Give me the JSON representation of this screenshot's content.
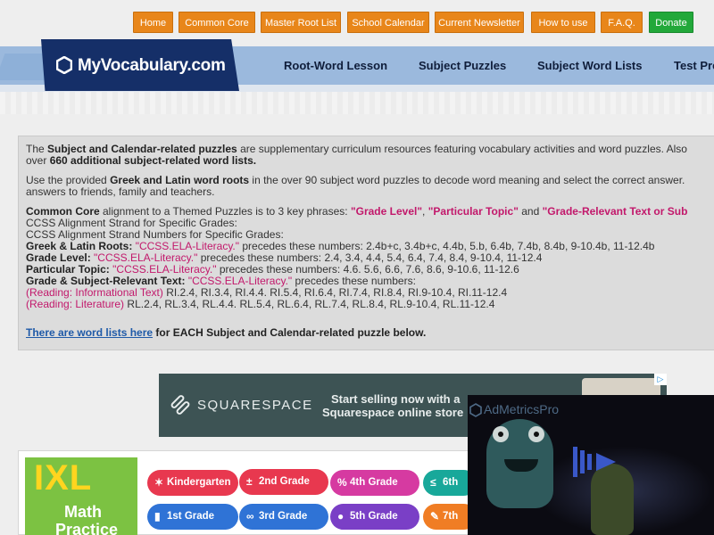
{
  "top_nav": [
    {
      "label": "Home"
    },
    {
      "label": "Common Core"
    },
    {
      "label": "Master Root List"
    },
    {
      "label": "School Calendar"
    },
    {
      "label": "Current Newsletter"
    },
    {
      "label": "How to use"
    },
    {
      "label": "F.A.Q."
    },
    {
      "label": "Donate"
    }
  ],
  "logo": {
    "text": "MyVocabulary.com"
  },
  "main_nav": [
    {
      "label": "Root-Word Lesson"
    },
    {
      "label": "Subject Puzzles"
    },
    {
      "label": "Subject Word Lists"
    },
    {
      "label": "Test Pre"
    }
  ],
  "intro": {
    "p1a": "The ",
    "p1b": "Subject and Calendar-related puzzles",
    "p1c": " are supplementary curriculum resources featuring vocabulary activities and word puzzles. Also",
    "p1d": "over ",
    "p1e": "660 additional subject-related word lists.",
    "p2a": "Use the provided ",
    "p2b": "Greek and Latin word roots",
    "p2c": " in the over 90 subject word puzzles to decode word meaning and select the correct answer.",
    "p2d": "answers to friends, family and teachers."
  },
  "common_core": {
    "l1a": "Common Core",
    "l1b": " alignment to a Themed Puzzles is to 3 key phrases: ",
    "phrase1": "\"Grade Level\"",
    "comma": ", ",
    "phrase2": "\"Particular Topic\"",
    "and": " and ",
    "phrase3": "\"Grade-Relevant Text or Sub",
    "l2": "CCSS Alignment Strand for Specific Grades:",
    "l3": "CCSS Alignment Strand Numbers for Specific Grades:",
    "roots_label": "Greek & Latin Roots: ",
    "roots_code": "\"CCSS.ELA-Literacy.\"",
    "roots_text": " precedes these numbers: 2.4b+c, 3.4b+c, 4.4b, 5.b, 6.4b, 7.4b, 8.4b, 9-10.4b, 11-12.4b",
    "grade_label": "Grade Level: ",
    "grade_code": "\"CCSS.ELA-Literacy.\"",
    "grade_text": " precedes these numbers: 2.4, 3.4, 4.4, 5.4, 6.4, 7.4, 8.4, 9-10.4, 11-12.4",
    "topic_label": "Particular Topic: ",
    "topic_code": "\"CCSS.ELA-Literacy.\"",
    "topic_text": " precedes these numbers: 4.6. 5.6, 6.6, 7.6, 8.6, 9-10.6, 11-12.6",
    "text_label": "Grade & Subject-Relevant Text: ",
    "text_code": "\"CCSS.ELA-Literacy.\"",
    "text_text": " precedes these numbers:",
    "info_label": "(Reading: Informational Text)",
    "info_text": " RI.2.4, RI.3.4, RI.4.4. RI.5.4, RI.6.4, RI.7.4, RI.8.4, RI.9-10.4, RI.11-12.4",
    "lit_label": "(Reading: Literature)",
    "lit_text": " RL.2.4, RL.3.4, RL.4.4. RL.5.4, RL.6.4, RL.7.4, RL.8.4, RL.9-10.4, RL.11-12.4",
    "link": "There are word lists here",
    "link_after": " for EACH Subject and Calendar-related puzzle below."
  },
  "ad": {
    "brand": "SQUARESPACE",
    "line1": "Start selling now with a",
    "line2": "Squarespace online store",
    "corner": "▷"
  },
  "ixl": {
    "mark": "IXL",
    "line1": "Math",
    "line2": "Practice",
    "grades": [
      {
        "label": "Kindergarten",
        "icon": "✶",
        "color": "#e8384f"
      },
      {
        "label": "2nd Grade",
        "icon": "±",
        "color": "#e8384f"
      },
      {
        "label": "4th Grade",
        "icon": "%",
        "color": "#d63aa1"
      },
      {
        "label": "6th",
        "icon": "≤",
        "color": "#18a89a"
      },
      {
        "label": "1st Grade",
        "icon": "▮",
        "color": "#2f73d6"
      },
      {
        "label": "3rd Grade",
        "icon": "∞",
        "color": "#2f73d6"
      },
      {
        "label": "5th Grade",
        "icon": "●",
        "color": "#7a3fc6"
      },
      {
        "label": "7th",
        "icon": "✎",
        "color": "#f07d24"
      }
    ]
  },
  "video": {
    "label": "AdMetricsPro"
  },
  "colors": {
    "nav_orange": "#e8861a",
    "donate_green": "#22a83a",
    "logo_navy": "#152f68",
    "band_blue": "#9bb9dd",
    "accent_pink": "#c2186b",
    "link_blue": "#1f5aa8"
  }
}
